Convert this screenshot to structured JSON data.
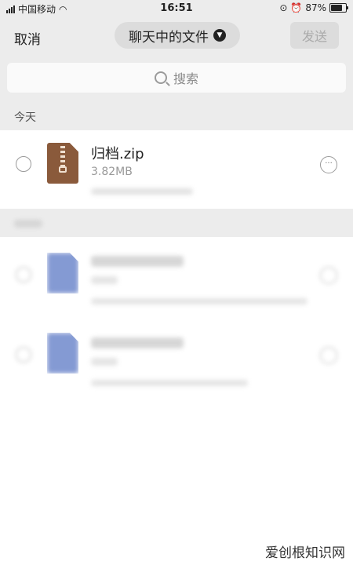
{
  "status_bar": {
    "carrier": "中国移动",
    "time": "16:51",
    "battery": "87%",
    "battery_level": 0.87
  },
  "nav": {
    "cancel": "取消",
    "title": "聊天中的文件",
    "send": "发送"
  },
  "search": {
    "placeholder": "搜索"
  },
  "sections": [
    {
      "label": "今天",
      "files": [
        {
          "name": "归档.zip",
          "size": "3.82MB",
          "icon": "zip-icon"
        }
      ]
    }
  ],
  "watermark": "爱创根知识网"
}
